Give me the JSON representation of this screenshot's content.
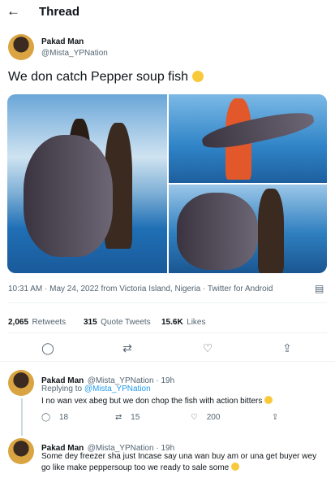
{
  "header": {
    "title": "Thread"
  },
  "tweet": {
    "author_name": "Pakad Man",
    "author_handle": "@Mista_YPNation",
    "text": "We don catch Pepper soup fish",
    "emoji": "smirk-face",
    "timestamp": "10:31 AM · May 24, 2022 from Victoria Island, Nigeria · Twitter for Android",
    "stats": {
      "retweets_num": "2,065",
      "retweets_lbl": "Retweets",
      "quotes_num": "315",
      "quotes_lbl": "Quote Tweets",
      "likes_num": "15.6K",
      "likes_lbl": "Likes"
    }
  },
  "replies": [
    {
      "author_name": "Pakad Man",
      "author_handle": "@Mista_YPNation · 19h",
      "replying_prefix": "Replying to",
      "replying_to": "@Mista_YPNation",
      "text": "I no wan vex abeg but we don chop the fish with action bitters",
      "reply_count": "18",
      "retweet_count": "15",
      "like_count": "200"
    },
    {
      "author_name": "Pakad Man",
      "author_handle": "@Mista_YPNation · 19h",
      "text_line1": "Some dey freezer sha just  Incase say una wan buy am or una get buyer wey",
      "text_line2": "go like make peppersoup too we ready to sale some"
    }
  ],
  "colors": {
    "accent": "#1d9bf0",
    "text": "#0f1419",
    "muted": "#536471"
  }
}
